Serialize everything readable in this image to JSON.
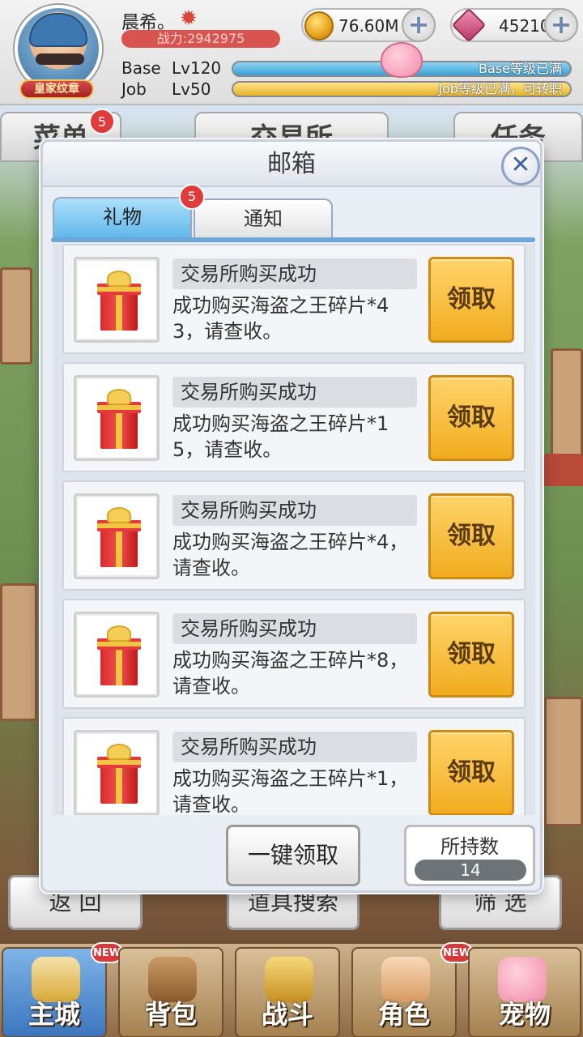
{
  "player": {
    "name": "晨希。",
    "badge": "皇家纹章",
    "power": "战力:2942975",
    "base_label": "Base",
    "base_level": "Lv120",
    "base_status": "Base等级已满",
    "job_label": "Job",
    "job_level": "Lv50",
    "job_status": "Job等级已满，可转职"
  },
  "currency": {
    "zeny": "76.60M",
    "gems": "45210",
    "plus": "+"
  },
  "background_header": {
    "left_tab": "菜单",
    "left_badge": "5",
    "center_tab": "交易所",
    "right_tab": "任务"
  },
  "mailbox": {
    "title": "邮箱",
    "close_symbol": "✕",
    "tabs": [
      {
        "label": "礼物",
        "active": true
      },
      {
        "label": "通知",
        "active": false
      }
    ],
    "tab_badge": "5",
    "claim_label": "领取",
    "items": [
      {
        "title": "交易所购买成功",
        "body": "成功购买海盗之王碎片*43，请查收。"
      },
      {
        "title": "交易所购买成功",
        "body": "成功购买海盗之王碎片*15，请查收。"
      },
      {
        "title": "交易所购买成功",
        "body": "成功购买海盗之王碎片*4，请查收。"
      },
      {
        "title": "交易所购买成功",
        "body": "成功购买海盗之王碎片*8，请查收。"
      },
      {
        "title": "交易所购买成功",
        "body": "成功购买海盗之王碎片*1，请查收。"
      }
    ],
    "claim_all_label": "一键领取",
    "held_label": "所持数",
    "held_value": "14"
  },
  "actions": {
    "back": "返 回",
    "item_search": "道具搜索",
    "filter": "筛 选"
  },
  "nav": {
    "items": [
      {
        "label": "主城",
        "new": "NEW"
      },
      {
        "label": "背包"
      },
      {
        "label": "战斗"
      },
      {
        "label": "角色",
        "new": "NEW"
      },
      {
        "label": "宠物"
      }
    ]
  },
  "colors": {
    "claim_button": "#f1ac1f",
    "active_tab": "#5db6ea",
    "badge": "#e03a3a"
  }
}
